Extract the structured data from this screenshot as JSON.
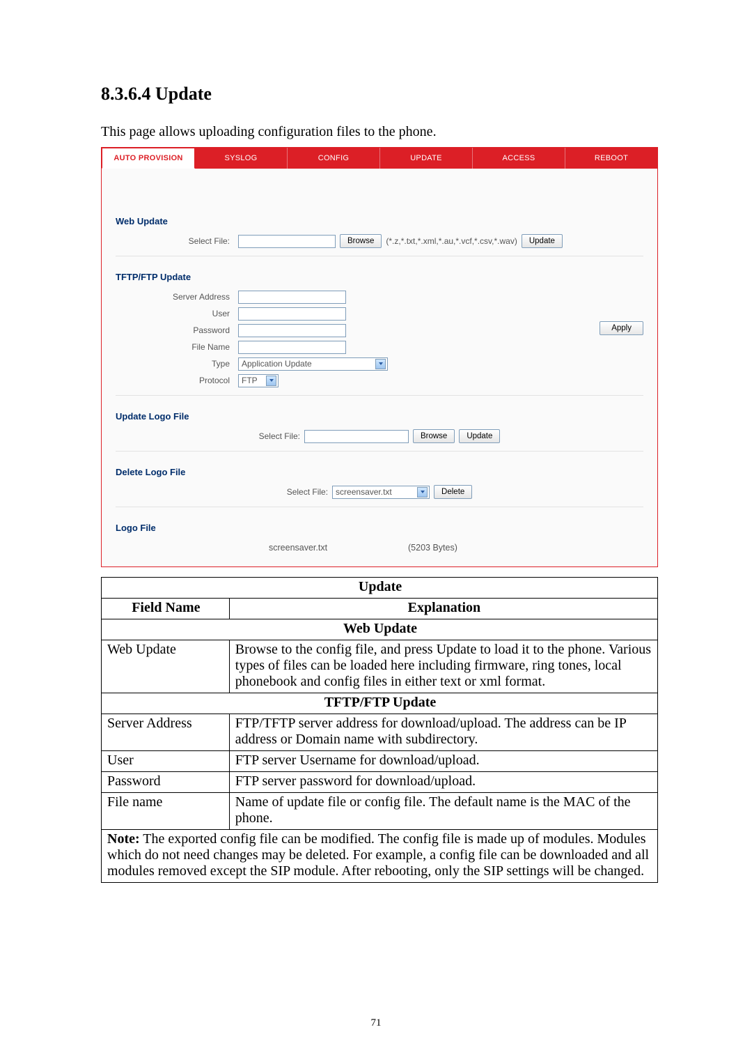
{
  "heading": "8.3.6.4   Update",
  "intro": "This page allows uploading configuration files to the phone.",
  "page_number": "71",
  "tabs": {
    "auto_provision": "AUTO PROVISION",
    "syslog": "SYSLOG",
    "config": "CONFIG",
    "update": "UPDATE",
    "access": "ACCESS",
    "reboot": "REBOOT"
  },
  "web_update": {
    "title": "Web Update",
    "select_file_label": "Select File:",
    "browse_btn": "Browse",
    "filetypes_hint": "(*.z,*.txt,*.xml,*.au,*.vcf,*.csv,*.wav)",
    "update_btn": "Update"
  },
  "tftp": {
    "title": "TFTP/FTP Update",
    "server_address_label": "Server Address",
    "user_label": "User",
    "password_label": "Password",
    "file_name_label": "File Name",
    "type_label": "Type",
    "type_value": "Application Update",
    "protocol_label": "Protocol",
    "protocol_value": "FTP",
    "apply_btn": "Apply"
  },
  "update_logo": {
    "title": "Update Logo File",
    "select_file_label": "Select File:",
    "browse_btn": "Browse",
    "update_btn": "Update"
  },
  "delete_logo": {
    "title": "Delete Logo File",
    "select_file_label": "Select File:",
    "file_selected": "screensaver.txt",
    "delete_btn": "Delete"
  },
  "logo_file": {
    "title": "Logo File",
    "file_name": "screensaver.txt",
    "file_size": "(5203 Bytes)"
  },
  "doc_table": {
    "title_row": "Update",
    "header_field": "Field Name",
    "header_explanation": "Explanation",
    "sub_web_update": "Web Update",
    "row_web_update_field": "Web Update",
    "row_web_update_exp": "Browse to the config file, and press Update to load it to the phone. Various types of files can be loaded here including firmware, ring tones, local phonebook and config files in either text or xml format.",
    "sub_tftp": "TFTP/FTP Update",
    "row_server_field": "Server Address",
    "row_server_exp": "FTP/TFTP server address for download/upload. The address can be IP address or Domain name with subdirectory.",
    "row_user_field": "User",
    "row_user_exp": "FTP server Username for download/upload.",
    "row_pw_field": "Password",
    "row_pw_exp": "FTP server password for download/upload.",
    "row_file_field": "File name",
    "row_file_exp": "Name of update file or config file. The default name is the MAC of the phone.",
    "note_label": "Note:",
    "note_rest": " The exported config file can be modified.    The config file is made up of modules. Modules which do not need changes may be deleted.    For example, a config file can be downloaded and all modules removed except the SIP module. After rebooting, only the SIP settings will be changed."
  }
}
